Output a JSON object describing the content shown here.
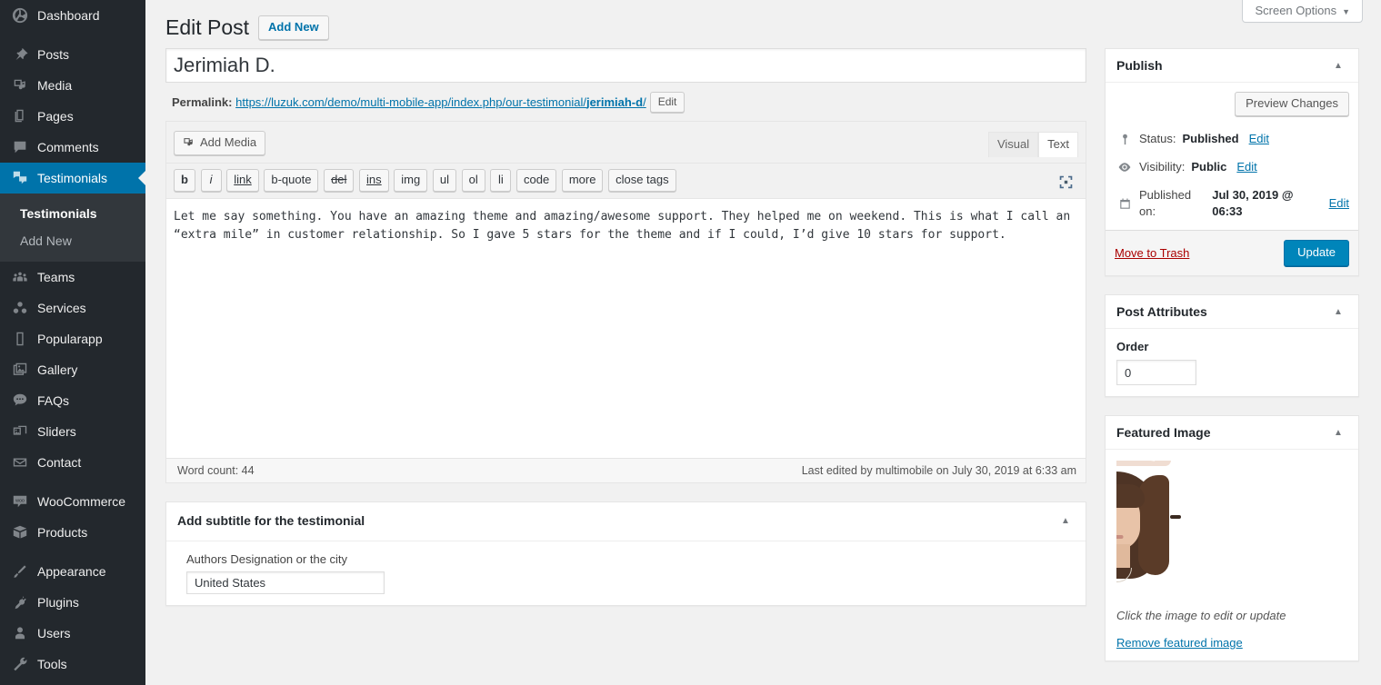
{
  "sidebar": {
    "items": [
      {
        "label": "Dashboard",
        "icon": "dashboard-icon",
        "current": false,
        "sep_after": true
      },
      {
        "label": "Posts",
        "icon": "pin-icon",
        "current": false,
        "sep_after": false
      },
      {
        "label": "Media",
        "icon": "media-icon",
        "current": false,
        "sep_after": false
      },
      {
        "label": "Pages",
        "icon": "pages-icon",
        "current": false,
        "sep_after": false
      },
      {
        "label": "Comments",
        "icon": "comments-icon",
        "current": false,
        "sep_after": false
      },
      {
        "label": "Testimonials",
        "icon": "testimonials-icon",
        "current": true,
        "sep_after": false
      },
      {
        "label": "Teams",
        "icon": "teams-icon",
        "current": false,
        "sep_after": false
      },
      {
        "label": "Services",
        "icon": "services-icon",
        "current": false,
        "sep_after": false
      },
      {
        "label": "Popularapp",
        "icon": "smartphone-icon",
        "current": false,
        "sep_after": false
      },
      {
        "label": "Gallery",
        "icon": "gallery-icon",
        "current": false,
        "sep_after": false
      },
      {
        "label": "FAQs",
        "icon": "faq-icon",
        "current": false,
        "sep_after": false
      },
      {
        "label": "Sliders",
        "icon": "sliders-icon",
        "current": false,
        "sep_after": false
      },
      {
        "label": "Contact",
        "icon": "email-icon",
        "current": false,
        "sep_after": true
      },
      {
        "label": "WooCommerce",
        "icon": "woocommerce-icon",
        "current": false,
        "sep_after": false
      },
      {
        "label": "Products",
        "icon": "products-icon",
        "current": false,
        "sep_after": true
      },
      {
        "label": "Appearance",
        "icon": "appearance-icon",
        "current": false,
        "sep_after": false
      },
      {
        "label": "Plugins",
        "icon": "plugins-icon",
        "current": false,
        "sep_after": false
      },
      {
        "label": "Users",
        "icon": "users-icon",
        "current": false,
        "sep_after": false
      },
      {
        "label": "Tools",
        "icon": "tools-icon",
        "current": false,
        "sep_after": false
      }
    ],
    "submenu": [
      {
        "label": "Testimonials",
        "current": true
      },
      {
        "label": "Add New",
        "current": false
      }
    ]
  },
  "screen_meta": {
    "screen_options_label": "Screen Options",
    "caret": "▼"
  },
  "header": {
    "title": "Edit Post",
    "add_new_label": "Add New"
  },
  "title_field": {
    "value": "Jerimiah D."
  },
  "permalink": {
    "label": "Permalink:",
    "url_prefix": "https://luzuk.com/demo/multi-mobile-app/index.php/our-testimonial/",
    "slug": "jerimiah-d",
    "url_suffix": "/",
    "edit_label": "Edit"
  },
  "editor": {
    "add_media_label": "Add Media",
    "tabs": [
      {
        "label": "Visual",
        "active": false
      },
      {
        "label": "Text",
        "active": true
      }
    ],
    "quicktags": [
      {
        "label": "b",
        "style": "qt-b"
      },
      {
        "label": "i",
        "style": "qt-i"
      },
      {
        "label": "link",
        "style": "qt-link"
      },
      {
        "label": "b-quote",
        "style": ""
      },
      {
        "label": "del",
        "style": "qt-del"
      },
      {
        "label": "ins",
        "style": "qt-ins"
      },
      {
        "label": "img",
        "style": ""
      },
      {
        "label": "ul",
        "style": ""
      },
      {
        "label": "ol",
        "style": ""
      },
      {
        "label": "li",
        "style": ""
      },
      {
        "label": "code",
        "style": ""
      },
      {
        "label": "more",
        "style": ""
      },
      {
        "label": "close tags",
        "style": ""
      }
    ],
    "content": "Let me say something. You have an amazing theme and amazing/awesome support. They helped me on weekend. This is what I call an “extra mile” in customer relationship. So I gave 5 stars for the theme and if I could, I’d give 10 stars for support.",
    "word_count": "Word count: 44",
    "last_edited": "Last edited by multimobile on July 30, 2019 at 6:33 am"
  },
  "subtitle_box": {
    "title": "Add subtitle for the testimonial",
    "field_label": "Authors Designation or the city",
    "field_value": "United States"
  },
  "publish_box": {
    "title": "Publish",
    "preview_label": "Preview Changes",
    "status_label": "Status:",
    "status_value": "Published",
    "status_edit": "Edit",
    "visibility_label": "Visibility:",
    "visibility_value": "Public",
    "visibility_edit": "Edit",
    "published_label": "Published on:",
    "published_value": "Jul 30, 2019 @ 06:33",
    "published_edit": "Edit",
    "trash_label": "Move to Trash",
    "update_label": "Update"
  },
  "attributes_box": {
    "title": "Post Attributes",
    "order_label": "Order",
    "order_value": "0"
  },
  "featured_image_box": {
    "title": "Featured Image",
    "hint": "Click the image to edit or update",
    "remove_label": "Remove featured image"
  },
  "colors": {
    "sidebar_bg": "#23282d",
    "sidebar_submenu_bg": "#32373c",
    "accent_blue": "#0073aa",
    "button_primary": "#0085ba",
    "link": "#0073aa",
    "trash_red": "#a00",
    "page_bg": "#f1f1f1"
  }
}
